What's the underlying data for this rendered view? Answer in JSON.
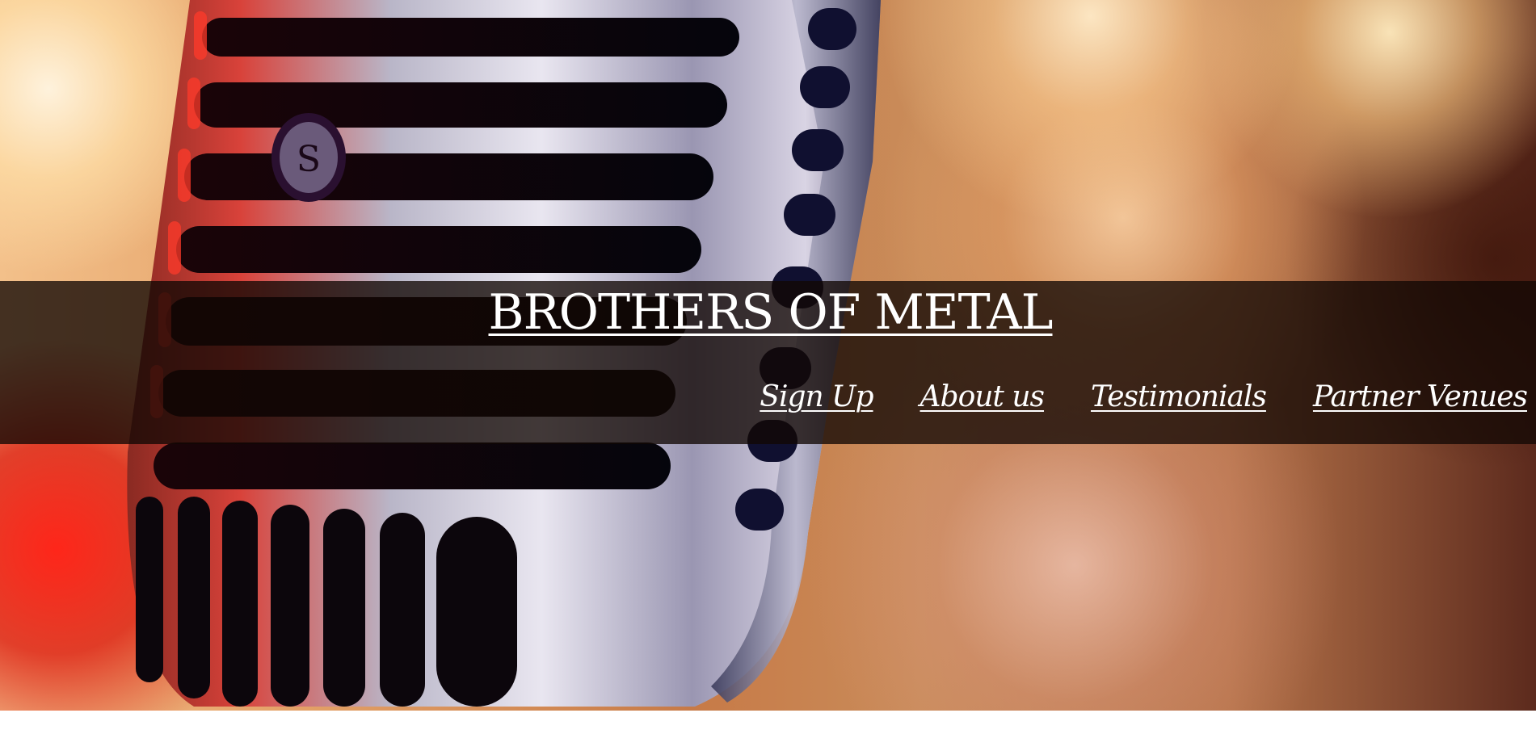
{
  "header": {
    "title": "BROTHERS OF METAL"
  },
  "nav": {
    "items": [
      {
        "label": "Sign Up"
      },
      {
        "label": "About us"
      },
      {
        "label": "Testimonials"
      },
      {
        "label": "Partner Venues"
      }
    ]
  },
  "hero": {
    "image_subject": "vintage-microphone-image",
    "accent_colors": {
      "band_overlay": "#120804",
      "warm_bokeh": "#f3c08a",
      "red_glow": "#ff1e14",
      "text": "#ffffff"
    }
  }
}
